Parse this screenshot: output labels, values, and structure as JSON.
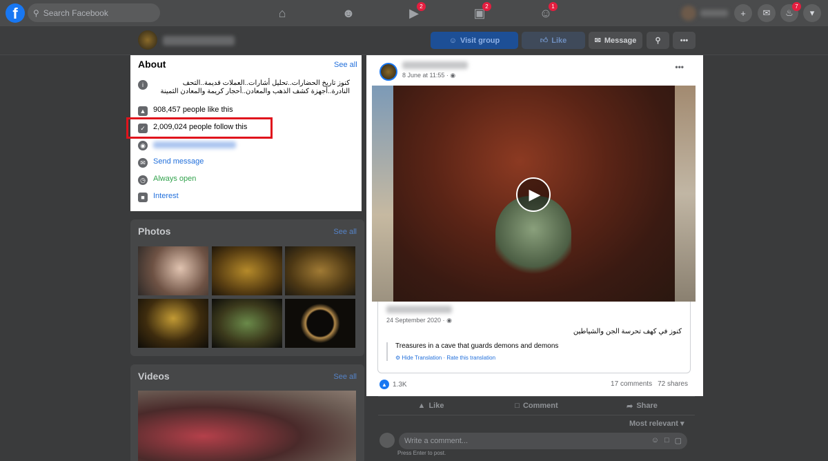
{
  "topbar": {
    "search_placeholder": "Search Facebook",
    "badges": {
      "watch": "2",
      "marketplace": "2",
      "groups": "1",
      "notifications": "7"
    }
  },
  "page_header": {
    "visit_group_label": "Visit group",
    "like_label": "Like",
    "message_label": "Message"
  },
  "about": {
    "title": "About",
    "see_all": "See all",
    "description": "كنوز تاريخ الحضارات..تحليل أشارات..العملات قديمة..التحف النادرة..أجهزة كشف الذهب والمعادن..أحجار كريمة والمعادن الثمينة",
    "likes": "908,457 people like this",
    "follows": "2,009,024 people follow this",
    "send_message": "Send message",
    "hours": "Always open",
    "category": "Interest"
  },
  "photos": {
    "title": "Photos",
    "see_all": "See all"
  },
  "videos": {
    "title": "Videos",
    "see_all": "See all"
  },
  "post": {
    "time": "8 June at 11:55 · ",
    "more": "•••",
    "shared_date": "24 September 2020 · ",
    "shared_text_ar": "كنوز في كهف تحرسة الجن والشياطين",
    "translation": "Treasures in a cave that guards demons and demons",
    "hide_translation": "Hide Translation",
    "rate_translation": "Rate this translation",
    "reactions": "1.3K",
    "comments": "17 comments",
    "shares": "72 shares"
  },
  "actions": {
    "like": "Like",
    "comment": "Comment",
    "share": "Share",
    "sort": "Most relevant",
    "comment_placeholder": "Write a comment...",
    "hint": "Press Enter to post."
  },
  "colors": {
    "brand": "#1877f2",
    "highlight": "#e0131c",
    "link": "#216fdb",
    "open": "#31a24c"
  }
}
